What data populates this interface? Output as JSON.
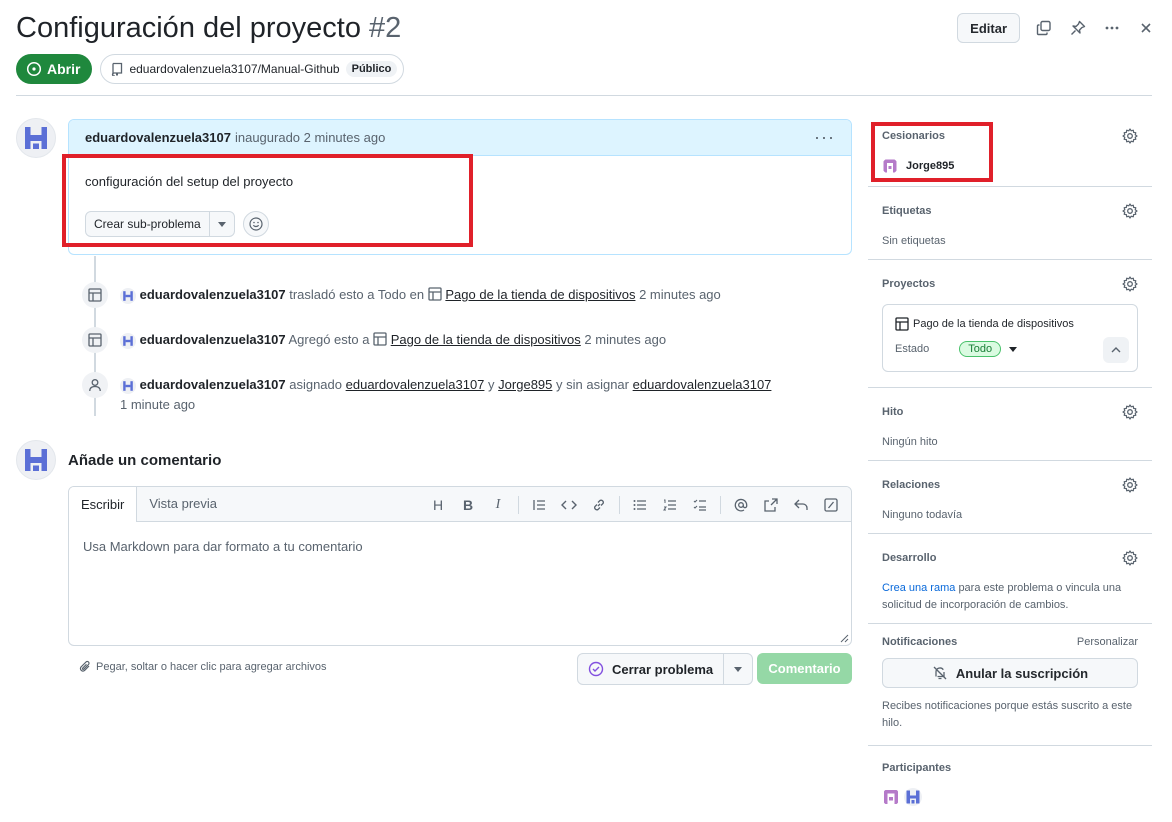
{
  "header": {
    "title": "Configuración del proyecto",
    "number": "#2",
    "edit_label": "Editar",
    "state_label": "Abrir",
    "repo": "eduardovalenzuela3107/Manual-Github",
    "visibility": "Público",
    "colors": {
      "open_green": "#1f883d",
      "highlight_red": "#e0202a"
    }
  },
  "comment": {
    "author": "eduardovalenzuela3107",
    "action": "inaugurado 2 minutes ago",
    "body": "configuración del setup del proyecto",
    "subissue_label": "Crear sub-problema"
  },
  "timeline": [
    {
      "user": "eduardovalenzuela3107",
      "text1": "trasladó esto a Todo en",
      "project": "Pago de la tienda de dispositivos",
      "time": "2 minutes ago"
    },
    {
      "user": "eduardovalenzuela3107",
      "text1": "Agregó esto a",
      "project": "Pago de la tienda de dispositivos",
      "time": "2 minutes ago"
    },
    {
      "user": "eduardovalenzuela3107",
      "text1": "asignado",
      "assignee1": "eduardovalenzuela3107",
      "conj": "y",
      "assignee2": "Jorge895",
      "text2": "y sin asignar",
      "unassigned": "eduardovalenzuela3107",
      "time": "1 minute ago"
    }
  ],
  "composer": {
    "title": "Añade un comentario",
    "tab_write": "Escribir",
    "tab_preview": "Vista previa",
    "placeholder": "Usa Markdown para dar formato a tu comentario",
    "paste_hint": "Pegar, soltar o hacer clic para agregar archivos",
    "close_label": "Cerrar problema",
    "comment_label": "Comentario"
  },
  "sidebar": {
    "assignees": {
      "title": "Cesionarios",
      "user": "Jorge895"
    },
    "labels": {
      "title": "Etiquetas",
      "value": "Sin etiquetas"
    },
    "projects": {
      "title": "Proyectos",
      "project": "Pago de la tienda de dispositivos",
      "status_label": "Estado",
      "status_value": "Todo"
    },
    "milestone": {
      "title": "Hito",
      "value": "Ningún hito"
    },
    "relations": {
      "title": "Relaciones",
      "value": "Ninguno todavía"
    },
    "development": {
      "title": "Desarrollo",
      "link": "Crea una rama",
      "value": "para este problema o vincula una solicitud de incorporación de cambios."
    },
    "notifications": {
      "title": "Notificaciones",
      "customize": "Personalizar",
      "unsubscribe": "Anular la suscripción",
      "reason": "Recibes notificaciones porque estás suscrito a este hilo."
    },
    "participants": {
      "title": "Participantes"
    }
  }
}
